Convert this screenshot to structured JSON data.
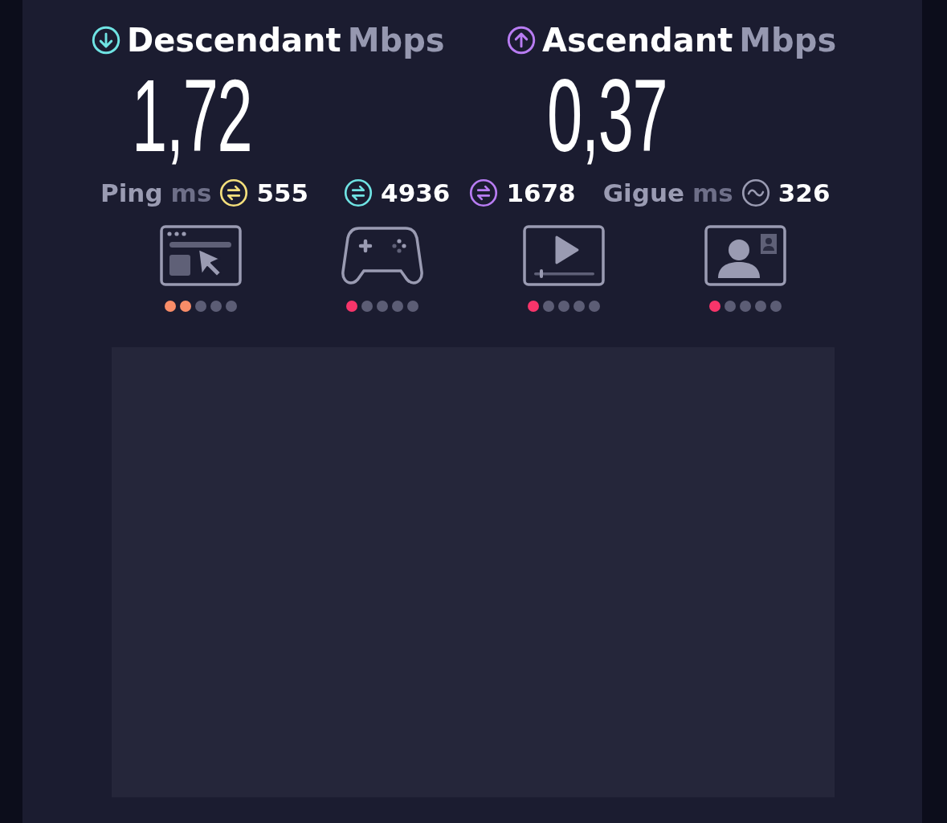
{
  "download": {
    "label": "Descendant",
    "unit": "Mbps",
    "value": "1,72"
  },
  "upload": {
    "label": "Ascendant",
    "unit": "Mbps",
    "value": "0,37"
  },
  "metrics": [
    {
      "kind": "ping",
      "label": "Ping",
      "unit": "ms",
      "color": "#f4df7c",
      "value": "555"
    },
    {
      "kind": "down",
      "color": "#6fe3e3",
      "value": "4936"
    },
    {
      "kind": "up",
      "color": "#b87cf2",
      "value": "1678"
    },
    {
      "kind": "jitter",
      "label": "Gigue",
      "unit": "ms",
      "color": "#9a9bb2",
      "value": "326"
    }
  ],
  "activities": [
    {
      "kind": "web",
      "stars": 2,
      "color": "#f98d68"
    },
    {
      "kind": "gaming",
      "stars": 1,
      "color": "#f7356a"
    },
    {
      "kind": "video",
      "stars": 1,
      "color": "#f7356a"
    },
    {
      "kind": "videocall",
      "stars": 1,
      "color": "#f7356a"
    }
  ]
}
